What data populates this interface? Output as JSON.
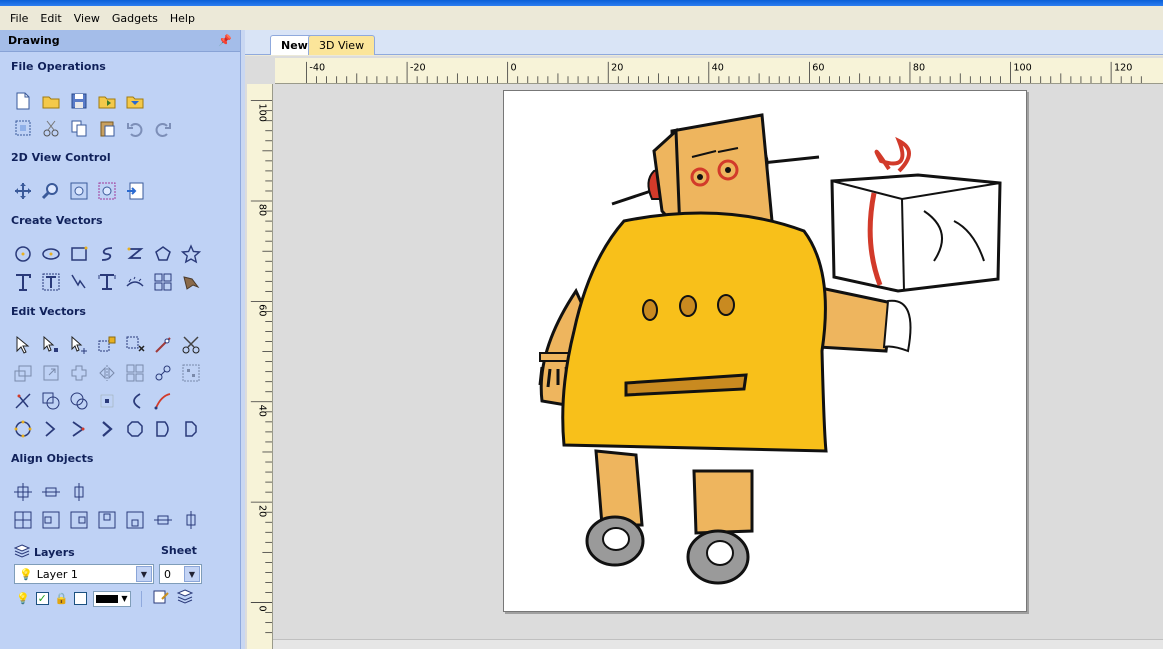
{
  "menu": {
    "items": [
      "File",
      "Edit",
      "View",
      "Gadgets",
      "Help"
    ]
  },
  "panel": {
    "title": "Drawing",
    "sections": {
      "file_operations": "File Operations",
      "view_control": "2D View Control",
      "create_vectors": "Create Vectors",
      "edit_vectors": "Edit Vectors",
      "align_objects": "Align Objects"
    },
    "layers": {
      "label": "Layers",
      "sheet_label": "Sheet",
      "layer_value": "Layer 1",
      "sheet_value": "0"
    }
  },
  "tabs": [
    {
      "label": "New",
      "active": true
    },
    {
      "label": "3D View",
      "active": false
    }
  ],
  "rulers": {
    "horizontal": [
      "-40",
      "-20",
      "0",
      "20",
      "40",
      "60",
      "80",
      "100",
      "120"
    ],
    "vertical": [
      "100",
      "80",
      "60",
      "40",
      "20",
      "0"
    ]
  },
  "colors": {
    "robot_body": "#f8c01a",
    "robot_head": "#eeb55e",
    "robot_accent": "#d23a2a",
    "panel_bg": "#bfd2f5",
    "ruler_bg": "#f7f3d8"
  }
}
